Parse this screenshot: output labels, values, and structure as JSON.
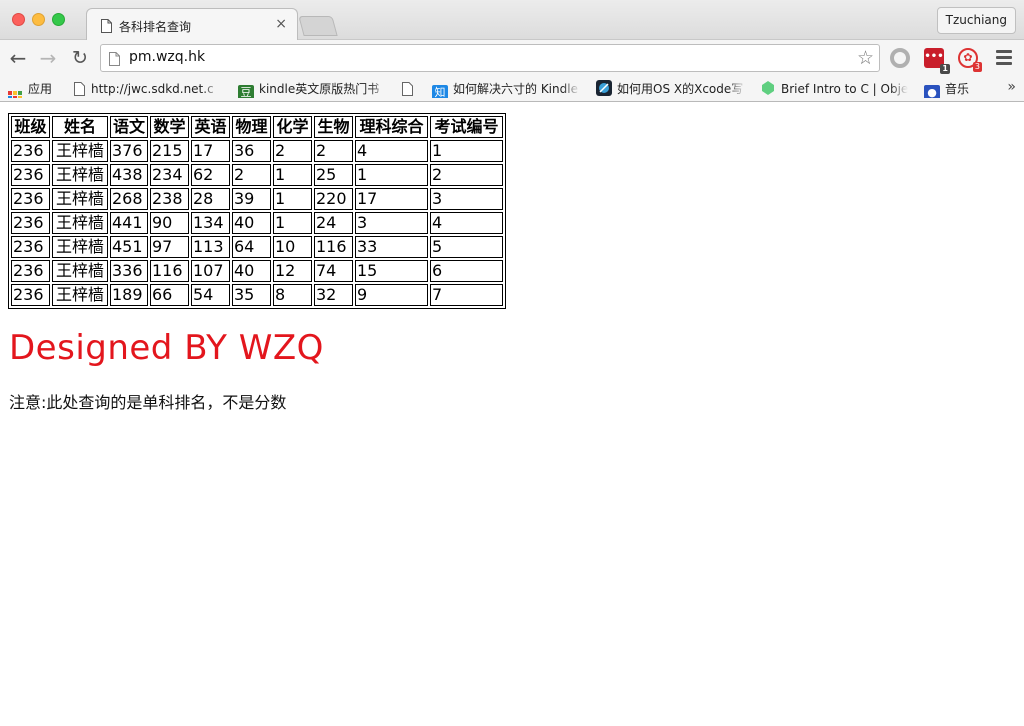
{
  "window": {
    "tab_title": "各科排名查询",
    "tab_close": "×",
    "profile_name": "Tzuchiang"
  },
  "toolbar": {
    "url": "pm.wzq.hk",
    "ext_red_badge": "1",
    "ext_pin_badge": "3"
  },
  "bookmarks": [
    {
      "label": "应用",
      "icon": "apps-grid-icon"
    },
    {
      "label": "http://jwc.sdkd.net.c",
      "icon": "page-icon"
    },
    {
      "label": "kindle英文原版热门书",
      "icon": "douban-icon"
    },
    {
      "label": "",
      "icon": "page-icon"
    },
    {
      "label": "如何解决六寸的 Kindle",
      "icon": "zhihu-icon"
    },
    {
      "label": "如何用OS X的Xcode写",
      "icon": "xcode-icon"
    },
    {
      "label": "Brief Intro to C | Obje",
      "icon": "treehouse-icon"
    },
    {
      "label": "音乐",
      "icon": "baidu-paw-icon"
    }
  ],
  "bookmarks_more": "»",
  "table": {
    "headers": [
      "班级",
      "姓名",
      "语文",
      "数学",
      "英语",
      "物理",
      "化学",
      "生物",
      "理科综合",
      "考试编号"
    ],
    "rows": [
      [
        "236",
        "王梓樯",
        "376",
        "215",
        "17",
        "36",
        "2",
        "2",
        "4",
        "1"
      ],
      [
        "236",
        "王梓樯",
        "438",
        "234",
        "62",
        "2",
        "1",
        "25",
        "1",
        "2"
      ],
      [
        "236",
        "王梓樯",
        "268",
        "238",
        "28",
        "39",
        "1",
        "220",
        "17",
        "3"
      ],
      [
        "236",
        "王梓樯",
        "441",
        "90",
        "134",
        "40",
        "1",
        "24",
        "3",
        "4"
      ],
      [
        "236",
        "王梓樯",
        "451",
        "97",
        "113",
        "64",
        "10",
        "116",
        "33",
        "5"
      ],
      [
        "236",
        "王梓樯",
        "336",
        "116",
        "107",
        "40",
        "12",
        "74",
        "15",
        "6"
      ],
      [
        "236",
        "王梓樯",
        "189",
        "66",
        "54",
        "35",
        "8",
        "32",
        "9",
        "7"
      ]
    ]
  },
  "designed_by": "Designed BY WZQ",
  "note": "注意:此处查询的是单科排名，不是分数",
  "colors": {
    "designed_text": "#e3161d"
  }
}
